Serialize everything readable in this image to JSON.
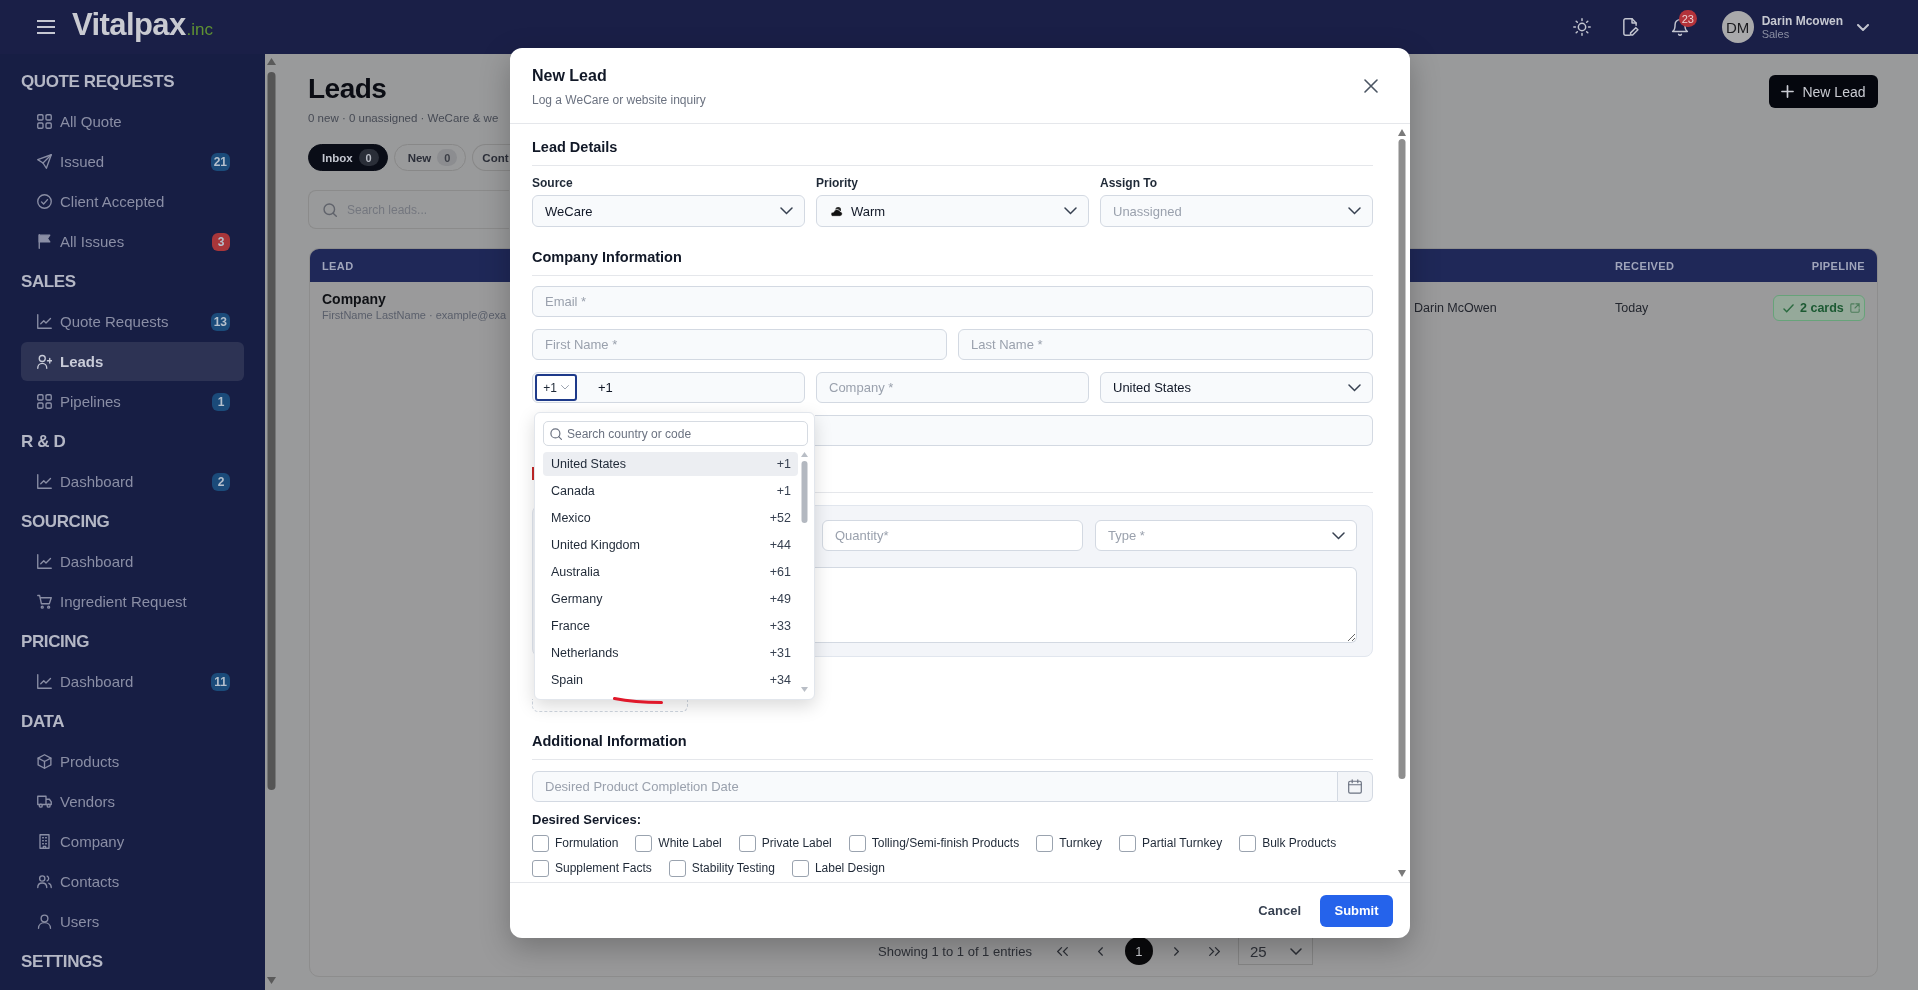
{
  "header": {
    "logo": {
      "text": "Vitalpax",
      "suffix": ".inc"
    },
    "notifications": "23",
    "user": {
      "initials": "DM",
      "name": "Darin Mcowen",
      "role": "Sales"
    }
  },
  "sidebar": {
    "sections": [
      {
        "title": "QUOTE REQUESTS",
        "items": [
          {
            "label": "All Quote",
            "selected": false
          },
          {
            "label": "Issued",
            "selected": false,
            "badge": {
              "text": "21",
              "color": "#1b4b7a"
            }
          },
          {
            "label": "Client Accepted",
            "selected": false
          },
          {
            "label": "All Issues",
            "selected": false,
            "badge": {
              "text": "3",
              "color": "#a8363a"
            }
          }
        ]
      },
      {
        "title": "SALES",
        "items": [
          {
            "label": "Quote Requests",
            "selected": false,
            "badge": {
              "text": "13",
              "color": "#1b4b7a"
            }
          },
          {
            "label": "Leads",
            "selected": true
          },
          {
            "label": "Pipelines",
            "selected": false,
            "badge": {
              "text": "1",
              "color": "#1b4b7a"
            }
          }
        ]
      },
      {
        "title": "R & D",
        "items": [
          {
            "label": "Dashboard",
            "selected": false,
            "badge": {
              "text": "2",
              "color": "#1b4b7a"
            }
          }
        ]
      },
      {
        "title": "SOURCING",
        "items": [
          {
            "label": "Dashboard",
            "selected": false
          },
          {
            "label": "Ingredient Request",
            "selected": false
          }
        ]
      },
      {
        "title": "PRICING",
        "items": [
          {
            "label": "Dashboard",
            "selected": false,
            "badge": {
              "text": "11",
              "color": "#1b4b7a"
            }
          }
        ]
      },
      {
        "title": "DATA",
        "items": [
          {
            "label": "Products",
            "selected": false
          },
          {
            "label": "Vendors",
            "selected": false
          },
          {
            "label": "Company",
            "selected": false
          },
          {
            "label": "Contacts",
            "selected": false
          },
          {
            "label": "Users",
            "selected": false
          }
        ]
      },
      {
        "title": "SETTINGS"
      }
    ]
  },
  "page": {
    "title": "Leads",
    "subtitle": "0 new · 0 unassigned · WeCare & we",
    "new_button": "New Lead",
    "tabs": [
      {
        "label": "Inbox",
        "count": "0",
        "selected": true
      },
      {
        "label": "New",
        "count": "0",
        "selected": false
      },
      {
        "label": "Cont",
        "selected": false
      }
    ],
    "search": {
      "placeholder": "Search leads..."
    },
    "table": {
      "columns": [
        "LEAD",
        "RECEIVED",
        "PIPELINE"
      ],
      "rows": [
        {
          "company": "Company",
          "contact": "FirstName LastName · example@exa",
          "owner": "Darin McOwen",
          "received": "Today",
          "pipeline": "2 cards"
        }
      ]
    },
    "pagination": {
      "summary": "Showing 1 to 1 of 1 entries",
      "pages": [
        {
          "label": "1",
          "selected": true
        }
      ],
      "page_size": "25"
    }
  },
  "modal": {
    "title": "New Lead",
    "subtitle": "Log a WeCare or website inquiry",
    "lead_details": {
      "title": "Lead Details",
      "fields": [
        {
          "label": "Source",
          "value": "WeCare"
        },
        {
          "label": "Priority",
          "value": "Warm"
        },
        {
          "label": "Assign To",
          "placeholder": "Unassigned"
        }
      ]
    },
    "company_information": {
      "title": "Company Information",
      "rows": [
        {
          "fields": [
            {
              "kind": "input",
              "placeholder": "Email *"
            }
          ]
        },
        {
          "fields": [
            {
              "kind": "input",
              "placeholder": "First Name *"
            },
            {
              "kind": "input",
              "placeholder": "Last Name *"
            }
          ]
        },
        {
          "fields": [
            {
              "kind": "phone",
              "code": "+1",
              "value": "+1",
              "expanded": true,
              "menu": {
                "search_placeholder": "Search country or code",
                "options": [
                  {
                    "name": "United States",
                    "code": "+1",
                    "selected": true
                  },
                  {
                    "name": "Canada",
                    "code": "+1",
                    "selected": false
                  },
                  {
                    "name": "Mexico",
                    "code": "+52",
                    "selected": false
                  },
                  {
                    "name": "United Kingdom",
                    "code": "+44",
                    "selected": false
                  },
                  {
                    "name": "Australia",
                    "code": "+61",
                    "selected": false
                  },
                  {
                    "name": "Germany",
                    "code": "+49",
                    "selected": false
                  },
                  {
                    "name": "France",
                    "code": "+33",
                    "selected": false
                  },
                  {
                    "name": "Netherlands",
                    "code": "+31",
                    "selected": false
                  },
                  {
                    "name": "Spain",
                    "code": "+34",
                    "selected": false
                  }
                ]
              }
            },
            {
              "kind": "input",
              "placeholder": "Company *"
            },
            {
              "kind": "select",
              "value": "United States"
            }
          ]
        },
        {
          "fields": [
            {
              "kind": "input"
            }
          ]
        }
      ]
    },
    "product": {
      "fields": [
        {
          "kind": "input",
          "placeholder": "Quantity*"
        },
        {
          "kind": "select",
          "placeholder": "Type *"
        }
      ]
    },
    "additional_information": {
      "title": "Additional Information",
      "date": {
        "placeholder": "Desired Product Completion Date"
      },
      "services_label": "Desired Services:",
      "services": [
        {
          "label": "Formulation",
          "checked": false
        },
        {
          "label": "White Label",
          "checked": false
        },
        {
          "label": "Private Label",
          "checked": false
        },
        {
          "label": "Tolling/Semi-finish Products",
          "checked": false
        },
        {
          "label": "Turnkey",
          "checked": false
        },
        {
          "label": "Partial Turnkey",
          "checked": false
        },
        {
          "label": "Bulk Products",
          "checked": false
        },
        {
          "label": "Supplement Facts",
          "checked": false
        },
        {
          "label": "Stability Testing",
          "checked": false
        },
        {
          "label": "Label Design",
          "checked": false
        }
      ]
    },
    "footer": {
      "cancel": "Cancel",
      "submit": "Submit"
    }
  }
}
